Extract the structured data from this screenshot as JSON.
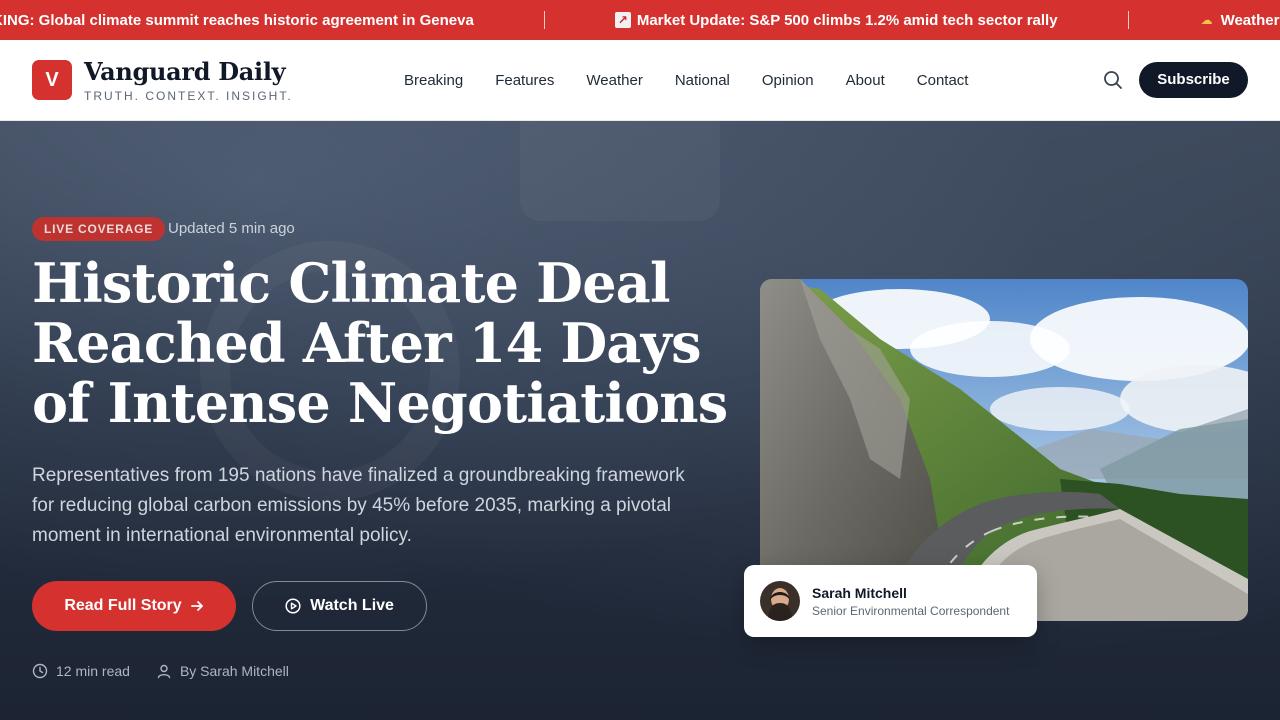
{
  "ticker": {
    "items": [
      {
        "text": "KING: Global climate summit reaches historic agreement in Geneva"
      },
      {
        "text": "Market Update: S&P 500 climbs 1.2% amid tech sector rally"
      },
      {
        "text": "Weather A"
      }
    ]
  },
  "header": {
    "logo_letter": "V",
    "brand_name": "Vanguard Daily",
    "tagline": "TRUTH. CONTEXT. INSIGHT.",
    "nav": [
      "Breaking",
      "Features",
      "Weather",
      "National",
      "Opinion",
      "About",
      "Contact"
    ],
    "subscribe_label": "Subscribe"
  },
  "hero": {
    "badge": "LIVE COVERAGE",
    "updated": "Updated 5 min ago",
    "headline": "Historic Climate Deal Reached After 14 Days of Intense Negotiations",
    "dek": "Representatives from 195 nations have finalized a groundbreaking framework for reducing global carbon emissions by 45% before 2035, marking a pivotal moment in international environmental policy.",
    "primary_cta": "Read Full Story",
    "secondary_cta": "Watch Live",
    "read_time": "12 min read",
    "byline": "By Sarah Mitchell",
    "author_name": "Sarah Mitchell",
    "author_role": "Senior Environmental Correspondent"
  },
  "colors": {
    "accent": "#d4312f",
    "dark": "#111827",
    "hero_bg": "#1e2633"
  }
}
